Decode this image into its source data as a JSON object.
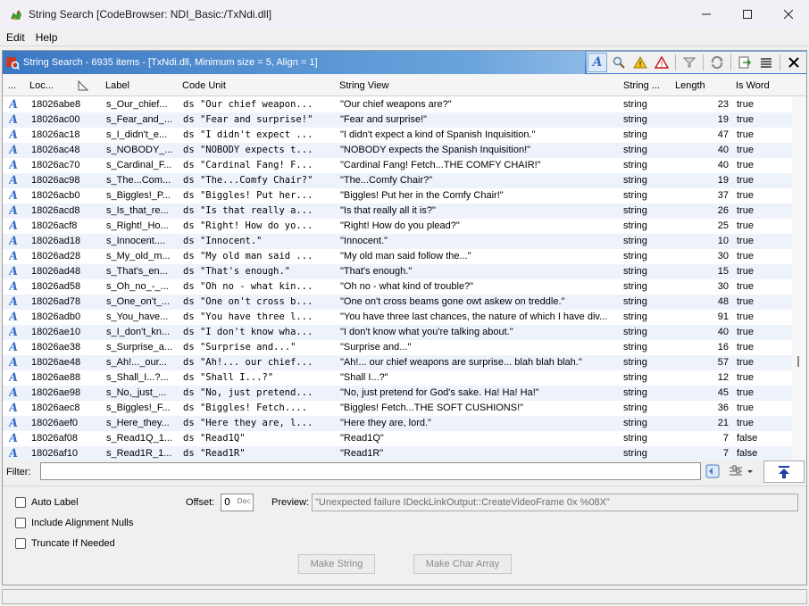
{
  "window": {
    "title": "String Search [CodeBrowser: NDI_Basic:/TxNdi.dll]",
    "minimize_icon": "minimize-icon",
    "maximize_icon": "maximize-icon",
    "close_icon": "close-icon"
  },
  "menu": {
    "items": [
      "Edit",
      "Help"
    ]
  },
  "panel": {
    "title": "String Search - 6935 items - [TxNdi.dll, Minimum size = 5, Align = 1]"
  },
  "columns": [
    "...",
    "Loc...",
    "Label",
    "Code Unit",
    "String View",
    "String ...",
    "Length",
    "Is Word"
  ],
  "rows": [
    {
      "loc": "18026abe8",
      "label": "s_Our_chief...",
      "code": "ds \"Our chief weapon...",
      "view": "\"Our chief weapons are?\"",
      "type": "string",
      "len": "23",
      "word": "true"
    },
    {
      "loc": "18026ac00",
      "label": "s_Fear_and_...",
      "code": "ds \"Fear and surprise!\"",
      "view": "\"Fear and surprise!\"",
      "type": "string",
      "len": "19",
      "word": "true"
    },
    {
      "loc": "18026ac18",
      "label": "s_I_didn't_e...",
      "code": "ds \"I didn't expect ...",
      "view": "\"I didn't expect a kind of Spanish Inquisition.\"",
      "type": "string",
      "len": "47",
      "word": "true"
    },
    {
      "loc": "18026ac48",
      "label": "s_NOBODY_...",
      "code": "ds \"NOBODY expects t...",
      "view": "\"NOBODY expects the Spanish Inquisition!\"",
      "type": "string",
      "len": "40",
      "word": "true"
    },
    {
      "loc": "18026ac70",
      "label": "s_Cardinal_F...",
      "code": "ds \"Cardinal Fang! F...",
      "view": "\"Cardinal Fang! Fetch...THE COMFY CHAIR!\"",
      "type": "string",
      "len": "40",
      "word": "true"
    },
    {
      "loc": "18026ac98",
      "label": "s_The...Com...",
      "code": "ds \"The...Comfy Chair?\"",
      "view": "\"The...Comfy Chair?\"",
      "type": "string",
      "len": "19",
      "word": "true"
    },
    {
      "loc": "18026acb0",
      "label": "s_Biggles!_P...",
      "code": "ds \"Biggles! Put her...",
      "view": "\"Biggles! Put her in the Comfy Chair!\"",
      "type": "string",
      "len": "37",
      "word": "true"
    },
    {
      "loc": "18026acd8",
      "label": "s_Is_that_re...",
      "code": "ds \"Is that really a...",
      "view": "\"Is that really all it is?\"",
      "type": "string",
      "len": "26",
      "word": "true"
    },
    {
      "loc": "18026acf8",
      "label": "s_Right!_Ho...",
      "code": "ds \"Right! How do yo...",
      "view": "\"Right! How do you plead?\"",
      "type": "string",
      "len": "25",
      "word": "true"
    },
    {
      "loc": "18026ad18",
      "label": "s_Innocent....",
      "code": "ds \"Innocent.\"",
      "view": "\"Innocent.\"",
      "type": "string",
      "len": "10",
      "word": "true"
    },
    {
      "loc": "18026ad28",
      "label": "s_My_old_m...",
      "code": "ds \"My old man said ...",
      "view": "\"My old man said follow the...\"",
      "type": "string",
      "len": "30",
      "word": "true"
    },
    {
      "loc": "18026ad48",
      "label": "s_That's_en...",
      "code": "ds \"That's enough.\"",
      "view": "\"That's enough.\"",
      "type": "string",
      "len": "15",
      "word": "true"
    },
    {
      "loc": "18026ad58",
      "label": "s_Oh_no_-_...",
      "code": "ds \"Oh no - what kin...",
      "view": "\"Oh no - what kind of trouble?\"",
      "type": "string",
      "len": "30",
      "word": "true"
    },
    {
      "loc": "18026ad78",
      "label": "s_One_on't_...",
      "code": "ds \"One on't cross b...",
      "view": "\"One on't cross beams gone owt askew on treddle.\"",
      "type": "string",
      "len": "48",
      "word": "true"
    },
    {
      "loc": "18026adb0",
      "label": "s_You_have...",
      "code": "ds \"You have three l...",
      "view": "\"You have three last chances, the nature of which I have div...",
      "type": "string",
      "len": "91",
      "word": "true"
    },
    {
      "loc": "18026ae10",
      "label": "s_I_don't_kn...",
      "code": "ds \"I don't know wha...",
      "view": "\"I don't know what you're talking about.\"",
      "type": "string",
      "len": "40",
      "word": "true"
    },
    {
      "loc": "18026ae38",
      "label": "s_Surprise_a...",
      "code": "ds \"Surprise and...\"",
      "view": "\"Surprise and...\"",
      "type": "string",
      "len": "16",
      "word": "true"
    },
    {
      "loc": "18026ae48",
      "label": "s_Ah!..._our...",
      "code": "ds \"Ah!... our chief...",
      "view": "\"Ah!... our chief weapons are surprise... blah blah blah.\"",
      "type": "string",
      "len": "57",
      "word": "true"
    },
    {
      "loc": "18026ae88",
      "label": "s_Shall_I...?...",
      "code": "ds \"Shall I...?\"",
      "view": "\"Shall I...?\"",
      "type": "string",
      "len": "12",
      "word": "true"
    },
    {
      "loc": "18026ae98",
      "label": "s_No,_just_...",
      "code": "ds \"No, just pretend...",
      "view": "\"No, just pretend for God's sake. Ha! Ha! Ha!\"",
      "type": "string",
      "len": "45",
      "word": "true"
    },
    {
      "loc": "18026aec8",
      "label": "s_Biggles!_F...",
      "code": "ds \"Biggles! Fetch....",
      "view": "\"Biggles! Fetch...THE SOFT CUSHIONS!\"",
      "type": "string",
      "len": "36",
      "word": "true"
    },
    {
      "loc": "18026aef0",
      "label": "s_Here_they...",
      "code": "ds \"Here they are, l...",
      "view": "\"Here they are, lord.\"",
      "type": "string",
      "len": "21",
      "word": "true"
    },
    {
      "loc": "18026af08",
      "label": "s_Read1Q_1...",
      "code": "ds \"Read1Q\"",
      "view": "\"Read1Q\"",
      "type": "string",
      "len": "7",
      "word": "false"
    },
    {
      "loc": "18026af10",
      "label": "s_Read1R_1...",
      "code": "ds \"Read1R\"",
      "view": "\"Read1R\"",
      "type": "string",
      "len": "7",
      "word": "false"
    }
  ],
  "filter": {
    "label": "Filter:",
    "value": ""
  },
  "options": {
    "auto_label": "Auto Label",
    "include_alignment_nulls": "Include Alignment Nulls",
    "truncate_if_needed": "Truncate If Needed",
    "offset_label": "Offset:",
    "offset_value": "0",
    "offset_unit": "Dec",
    "preview_label": "Preview:",
    "preview_value": "\"Unexpected failure IDeckLinkOutput::CreateVideoFrame 0x %08X\"",
    "make_string": "Make String",
    "make_char_array": "Make Char Array"
  },
  "colors": {
    "panel_header": "#3a7ccd",
    "string_icon": "#3a6fc4",
    "row_alt": "#eef3fb"
  }
}
